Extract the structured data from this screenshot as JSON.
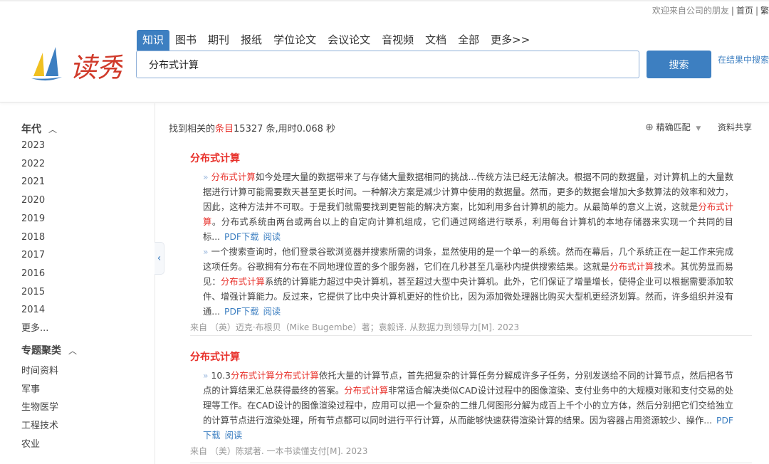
{
  "topbar": {
    "welcome": "欢迎来自公司的朋友",
    "home": "首页",
    "traditional": "繁"
  },
  "brand": {
    "logo_text": "读秀"
  },
  "tabs": [
    "知识",
    "图书",
    "期刊",
    "报纸",
    "学位论文",
    "会议论文",
    "音视频",
    "文档",
    "全部",
    "更多>>"
  ],
  "search": {
    "value": "分布式计算",
    "button": "搜索",
    "in_results": "在结果中搜索"
  },
  "sidebar": {
    "year_title": "年代",
    "years": [
      "2023",
      "2022",
      "2021",
      "2020",
      "2019",
      "2018",
      "2017",
      "2016",
      "2015",
      "2014"
    ],
    "more": "更多...",
    "topic_title": "专题聚类",
    "topics": [
      "时间资料",
      "军事",
      "生物医学",
      "工程技术",
      "农业"
    ]
  },
  "summary": {
    "prefix": "找到相关的",
    "highlight": "条目",
    "rest": "15327 条,用时0.068 秒"
  },
  "toolbar": {
    "match": "精确匹配",
    "share": "资料共享"
  },
  "colors": {
    "accent": "#3d7fc1",
    "highlight": "#e8302a"
  },
  "results": [
    {
      "title": "分布式计算",
      "snippets": [
        {
          "segments": [
            {
              "t": "分布式计算",
              "h": true
            },
            {
              "t": "如今处理大量的数据带来了与存储大量数据相同的挑战...传统方法已经无法解决。根据不同的数据量，对计算机上的大量数据进行计算可能需要数天甚至更长时间。一种解决方案是减少计算中使用的数据量。然而，更多的数据会增加大多数算法的效率和效力，因此，这种方法并不可取。于是我们就需要找到更智能的解决方案，比如利用多台计算机的能力。从最简单的意义上说，这就是",
              "h": false
            },
            {
              "t": "分布式计算",
              "h": true
            },
            {
              "t": "。分布式系统由两台或两台以上的自定向计算机组成，它们通过网络进行联系，利用每台计算机的本地存储器来实现一个共同的目标...",
              "h": false
            }
          ],
          "pdf": "PDF下载",
          "read": "阅读"
        },
        {
          "segments": [
            {
              "t": "一个搜索查询时，他们登录谷歌浏览器并搜索所需的词条，显然使用的是一个单一的系统。然而在幕后，几个系统正在一起工作来完成这项任务。谷歌拥有分布在不同地理位置的多个服务器，它们在几秒甚至几毫秒内提供搜索结果。这就是",
              "h": false
            },
            {
              "t": "分布式计算",
              "h": true
            },
            {
              "t": "技术。其优势显而易见：",
              "h": false
            },
            {
              "t": "分布式计算",
              "h": true
            },
            {
              "t": "系统的计算能力超过中央计算机，甚至超过大型中央计算机。此外，它们保证了增量增长，使得企业可以根据需要添加软件、增强计算能力。反过来，它提供了比中央计算机更好的性价比，因为添加微处理器比购买大型机更经济划算。然而，许多组织并没有通...",
              "h": false
            }
          ],
          "pdf": "PDF下载",
          "read": "阅读"
        }
      ],
      "source": "来自 （英）迈克·布根贝（Mike Bugembe）著；袁毅译. 从数据力到领导力[M]. 2023"
    },
    {
      "title": "分布式计算",
      "snippets": [
        {
          "segments": [
            {
              "t": "10.3",
              "h": false
            },
            {
              "t": "分布式计算分布式计算",
              "h": true
            },
            {
              "t": "依托大量的计算节点，首先把复杂的计算任务分解成许多子任务，分别发送给不同的计算节点，然后把各节点的计算结果汇总获得最终的答案。",
              "h": false
            },
            {
              "t": "分布式计算",
              "h": true
            },
            {
              "t": "非常适合解决类似CAD设计过程中的图像渲染、支付业务中的大规模对账和支付交易的处理等工作。在CAD设计的图像渲染过程中，应用可以把一个复杂的二维几何图形分解为成百上千个小的立方体，然后分别把它们交给独立的计算节点进行渲染处理，所有节点都可以同时进行平行计算，从而能够快速获得渲染计算的结果。因为容器占用资源较少、操作...",
              "h": false
            }
          ],
          "pdf": "PDF下载",
          "read": "阅读"
        }
      ],
      "source": "来自 （美）陈斌著. 一本书读懂支付[M]. 2023"
    }
  ]
}
